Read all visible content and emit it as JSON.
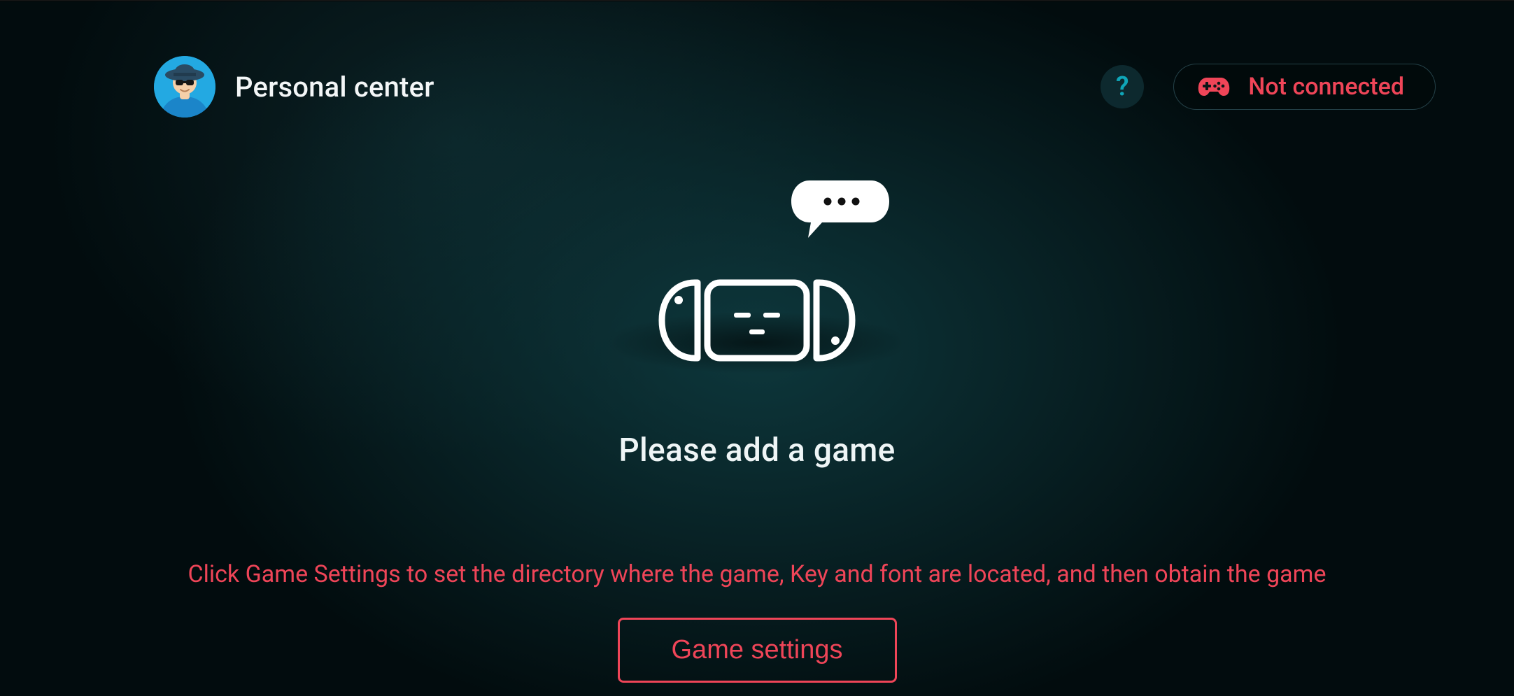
{
  "header": {
    "title": "Personal center",
    "help_symbol": "?",
    "status": {
      "label": "Not connected",
      "icon": "gamepad-icon"
    }
  },
  "empty_state": {
    "heading": "Please add a game",
    "instruction": "Click Game Settings to set the directory where the game, Key and font are located, and then obtain the game",
    "button_label": "Game settings"
  },
  "colors": {
    "accent_red": "#ef4558",
    "accent_teal": "#0fa6b8"
  }
}
